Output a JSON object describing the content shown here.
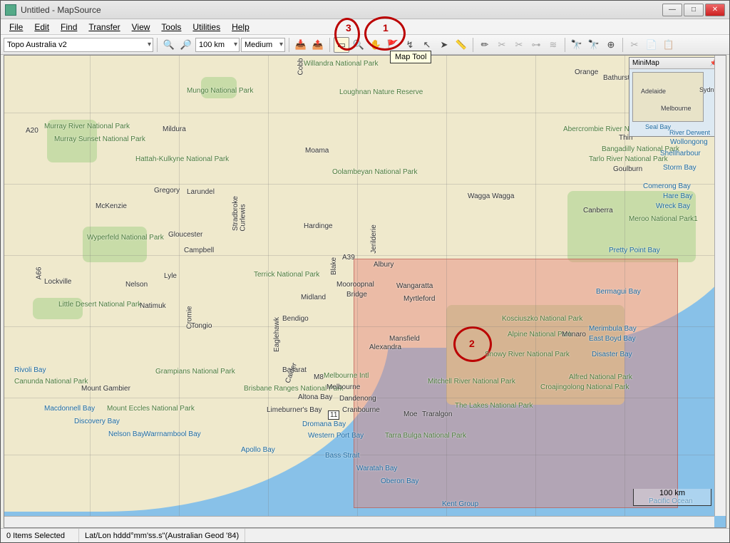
{
  "window": {
    "title": "Untitled - MapSource"
  },
  "menu": {
    "file": "File",
    "edit": "Edit",
    "find": "Find",
    "transfer": "Transfer",
    "view": "View",
    "tools": "Tools",
    "utilities": "Utilities",
    "help": "Help"
  },
  "toolbar": {
    "product": "Topo Australia v2",
    "zoom_scale": "100 km",
    "detail": "Medium"
  },
  "tooltip": {
    "maptool": "Map Tool"
  },
  "annotations": {
    "n1": "1",
    "n2": "2",
    "n3": "3"
  },
  "minimap": {
    "title": "MiniMap",
    "l1": "Adelaide",
    "l2": "Melbourne",
    "l3": "Sydne",
    "l4": "Seal Bay",
    "l5": "River Derwent"
  },
  "scale": {
    "label": "100 km"
  },
  "status": {
    "items": "0 Items Selected",
    "coordfmt": "Lat/Lon hddd°mm'ss.s\"(Australian Geod '84)"
  },
  "labels": {
    "willandra": "Willandra National Park",
    "mungo": "Mungo National Park",
    "loughnan": "Loughnan Nature Reserve",
    "cobb": "Cobb",
    "orange": "Orange",
    "bathurst": "Bathurst",
    "mildura": "Mildura",
    "a20": "A20",
    "murray": "Murray River National Park",
    "murraysun": "Murray Sunset National Park",
    "hattah": "Hattah-Kulkyne National Park",
    "abercrombie": "Abercrombie River National",
    "thirl": "Thirl",
    "bangadilly": "Bangadilly National Park",
    "wollongong": "Wollongong",
    "shellharbour": "Shellharbour",
    "tarlo": "Tarlo River National Park",
    "goulburn": "Goulburn",
    "stormbay": "Storm Bay",
    "moama": "Moama",
    "oolambeyan": "Oolambeyan National Park",
    "comerong": "Comerong Bay",
    "harebay": "Hare Bay",
    "wreckbay": "Wreck Bay",
    "gregory": "Gregory",
    "larundel": "Larundel",
    "mckenzie": "McKenzie",
    "wagga": "Wagga Wagga",
    "canberra": "Canberra",
    "meroo": "Meroo National Park1",
    "stradbroke": "Stradbroke",
    "curlewis": "Curlewis",
    "gloucester": "Gloucester",
    "hardinge": "Hardinge",
    "jerilderie": "Jerilderie",
    "wyperfeld": "Wyperfeld National Park",
    "campbell": "Campbell",
    "blake": "Blake",
    "a39": "A39",
    "prettypoint": "Pretty Point Bay",
    "a66": "A66",
    "lockville": "Lockville",
    "lyle": "Lyle",
    "terrick": "Terrick National Park",
    "albury": "Albury",
    "nelson": "Nelson",
    "mooroopnal": "Mooroopnal",
    "wangaratta": "Wangaratta",
    "bermagui": "Bermagui Bay",
    "littledesert": "Little Desert National Park",
    "natimuk": "Natimuk",
    "cromie": "Cromie",
    "midland": "Midland",
    "bridge": "Bridge",
    "myrtleford": "Myrtleford",
    "kosciuszko": "Kosciuszko National Park",
    "tongio": "Tongio",
    "bendigo": "Bendigo",
    "eaglehawk": "Eaglehawk",
    "alpine": "Alpine National Park",
    "monaro": "Monaro",
    "merimbula": "Merimbula Bay",
    "eastboyd": "East Boyd Bay",
    "mansfield": "Mansfield",
    "alexandra": "Alexandra",
    "snowy": "Snowy River National Park",
    "disaster": "Disaster Bay",
    "rivoli": "Rivoli Bay",
    "canunda": "Canunda National Park",
    "grampians": "Grampians National Park",
    "ballarat": "Ballarat",
    "m8": "M8",
    "melbourneint": "Melbourne Intl",
    "mitchell": "Mitchell River National Park",
    "alfred": "Alfred National Park",
    "croajingolong": "Croajingolong National Park",
    "mtgambier": "Mount Gambier",
    "mteccles": "Mount Eccles National Park",
    "brisbaneranges": "Brisbane Ranges National Park",
    "melbourne": "Melbourne",
    "altona": "Altona Bay",
    "dandenong": "Dandenong",
    "lakes": "The Lakes National Park",
    "macdonnell": "Macdonnell Bay",
    "limeburners": "Limeburner's Bay",
    "cranbourne": "Cranbourne",
    "eleven": "11",
    "discovery": "Discovery Bay",
    "dromana": "Dromana Bay",
    "moe": "Moe",
    "traralgon": "Traralgon",
    "calder": "Calder",
    "nelsonbay": "Nelson Bay",
    "warrnambool": "Warrnambool Bay",
    "westernport": "Western Port Bay",
    "tarrabulga": "Tarra Bulga National Park",
    "apollo": "Apollo Bay",
    "bassstrait": "Bass Strait",
    "waratah": "Waratah Bay",
    "oberon": "Oberon Bay",
    "kent": "Kent Group",
    "pacific": "Pacific Ocean"
  },
  "chart_data": null
}
